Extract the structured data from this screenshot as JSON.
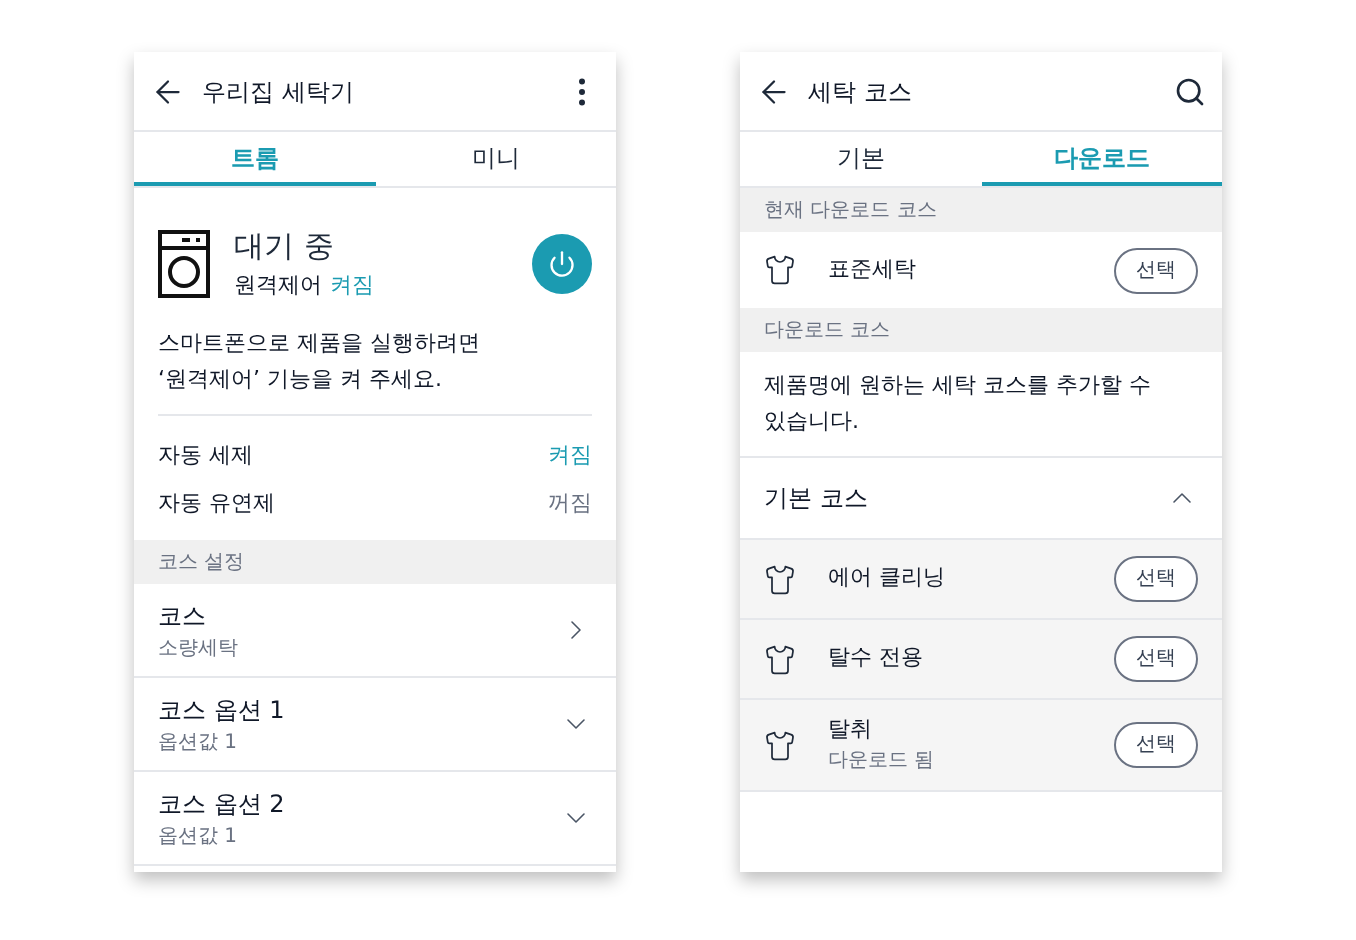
{
  "left": {
    "title": "우리집 세탁기",
    "tabs": [
      {
        "label": "트롬",
        "selected": true
      },
      {
        "label": "미니",
        "selected": false
      }
    ],
    "status": "대기 중",
    "remote_label": "원격제어",
    "remote_value": "켜짐",
    "remote_on": true,
    "message": "스마트폰으로 제품을 실행하려면\n‘원격제어’ 기능을 켜 주세요.",
    "settings": [
      {
        "label": "자동 세제",
        "value": "켜짐",
        "on": true
      },
      {
        "label": "자동 유연제",
        "value": "꺼짐",
        "on": false
      }
    ],
    "section": "코스 설정",
    "courses": [
      {
        "title": "코스",
        "subtitle": "소량세탁",
        "kind": "link"
      },
      {
        "title": "코스 옵션 1",
        "subtitle": "옵션값 1",
        "kind": "dropdown"
      },
      {
        "title": "코스 옵션 2",
        "subtitle": "옵션값 1",
        "kind": "dropdown"
      }
    ]
  },
  "right": {
    "title": "세탁 코스",
    "tabs": [
      {
        "label": "기본",
        "selected": false
      },
      {
        "label": "다운로드",
        "selected": true
      }
    ],
    "current_section": "현재 다운로드 코스",
    "current_course": {
      "name": "표준세탁",
      "button": "선택"
    },
    "download_section": "다운로드 코스",
    "description": "제품명에 원하는 세탁 코스를 추가할 수\n있습니다.",
    "basic": {
      "title": "기본 코스",
      "expanded": true,
      "items": [
        {
          "name": "에어 클리닝",
          "button": "선택"
        },
        {
          "name": "탈수 전용",
          "button": "선택"
        },
        {
          "name": "탈취",
          "subtitle": "다운로드 됨",
          "button": "선택"
        }
      ]
    }
  }
}
